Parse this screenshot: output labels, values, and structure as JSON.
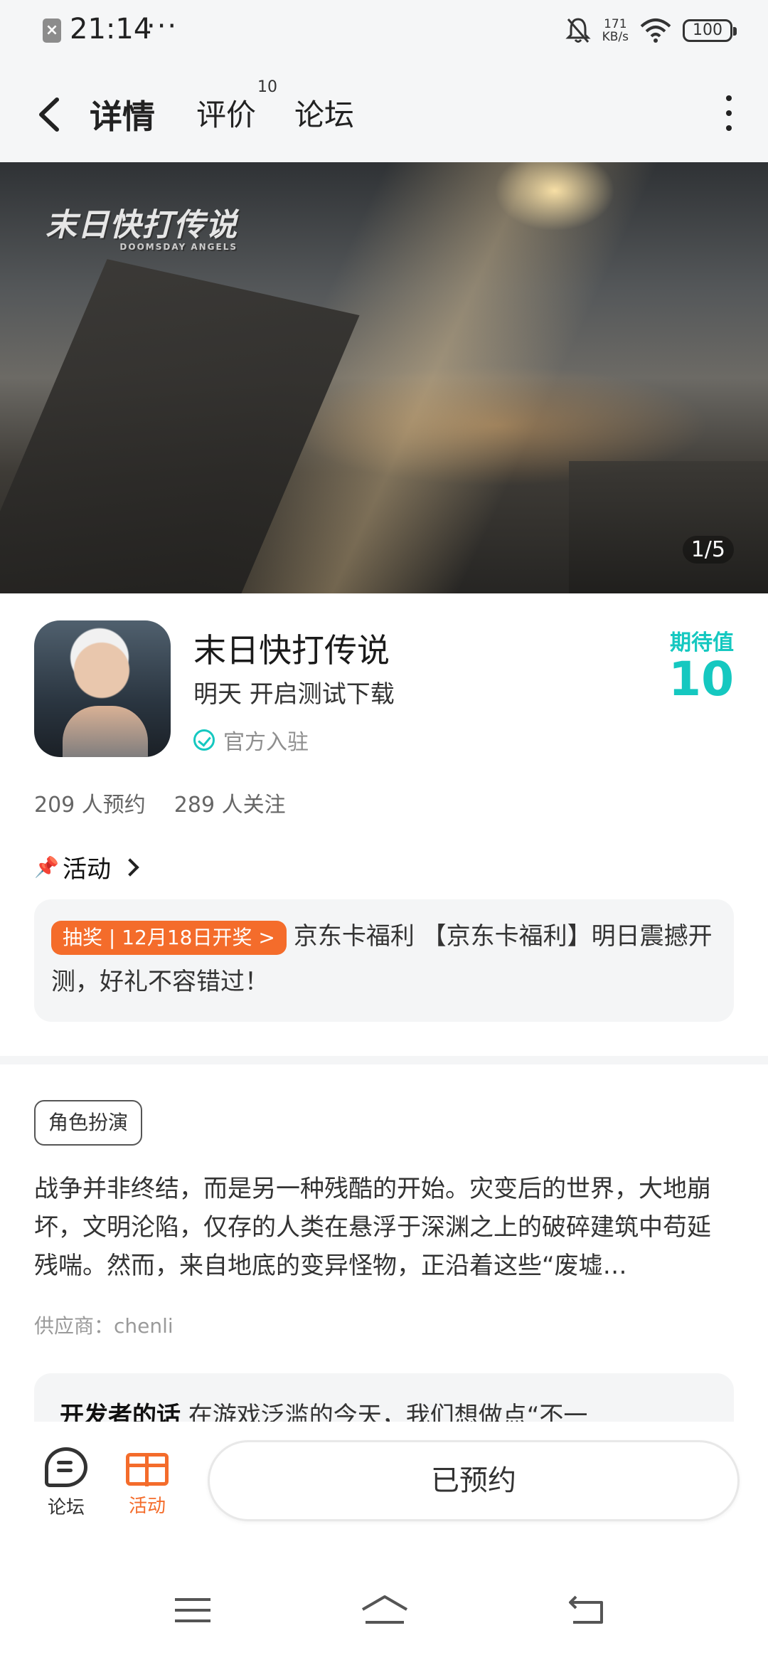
{
  "status_bar": {
    "time": "21:14",
    "more": "···",
    "speed_value": "171",
    "speed_unit": "KB/s",
    "battery": "100"
  },
  "nav": {
    "tabs": [
      {
        "label": "详情"
      },
      {
        "label": "评价",
        "badge": "10"
      },
      {
        "label": "论坛"
      }
    ]
  },
  "banner": {
    "logo_text": "末日快打传说",
    "logo_sub": "DOOMSDAY ANGELS",
    "counter": "1/5"
  },
  "game": {
    "title": "末日快打传说",
    "status": "明天 开启测试下载",
    "official_label": "官方入驻",
    "expect_label": "期待值",
    "expect_value": "10",
    "reservations": "209 人预约",
    "followers": "289 人关注"
  },
  "activity": {
    "title": "活动",
    "tag": "抽奖 | 12月18日开奖 >",
    "text": "京东卡福利 【京东卡福利】明日震撼开测，好礼不容错过！"
  },
  "details": {
    "genre": "角色扮演",
    "description": "战争并非终结，而是另一种残酷的开始。灾变后的世界，大地崩坏，文明沦陷，仅存的人类在悬浮于深渊之上的破碎建筑中苟延残喘。然而，来自地底的变异怪物，正沿着这些“废墟…",
    "provider": "供应商：chenli",
    "dev_title": "开发者的话",
    "dev_text": "在游戏泛滥的今天，我们想做点“不一"
  },
  "bottom_bar": {
    "forum_label": "论坛",
    "activity_label": "活动",
    "reserve_label": "已预约"
  },
  "colors": {
    "accent": "#15c8c0",
    "orange": "#f46c2b"
  }
}
